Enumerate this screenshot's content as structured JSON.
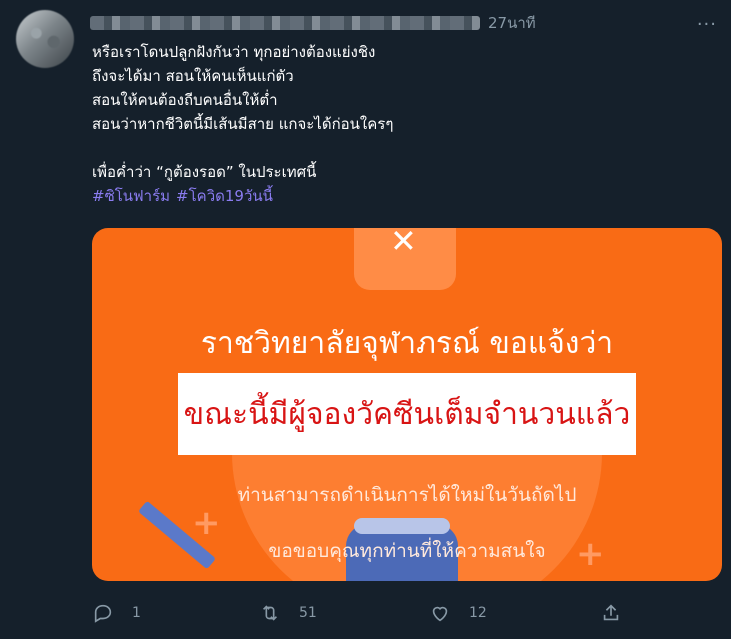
{
  "tweet": {
    "timestamp": "27นาที",
    "more_label": "···",
    "lines": [
      "หรือเราโดนปลูกฝังกันว่า ทุกอย่างต้องแย่งชิง",
      "ถึงจะได้มา สอนให้คนเห็นแก่ตัว",
      "สอนให้คนต้องถีบคนอื่นให้ต่ำ",
      "สอนว่าหากชีวิตนี้มีเส้นมีสาย แกจะได้ก่อนใครๆ",
      "",
      "เพื่อค่ำว่า “กูต้องรอด” ในประเทศนี้"
    ],
    "hashtags": [
      "#ซิโนฟาร์ม",
      "#โควิด19วันนี้"
    ]
  },
  "image": {
    "title": "ราชวิทยาลัยจุฬาภรณ์ ขอแจ้งว่า",
    "banner": "ขณะนี้มีผู้จองวัคซีนเต็มจำนวนแล้ว",
    "line2": "ท่านสามารถดำเนินการได้ใหม่ในวันถัดไป",
    "line3": "ขอขอบคุณทุกท่านที่ให้ความสนใจ",
    "colors": {
      "background": "#f96b15",
      "banner_text": "#d81414"
    }
  },
  "actions": {
    "reply_count": "1",
    "retweet_count": "51",
    "like_count": "12",
    "icons": [
      "reply-icon",
      "retweet-icon",
      "like-icon",
      "share-icon"
    ]
  }
}
